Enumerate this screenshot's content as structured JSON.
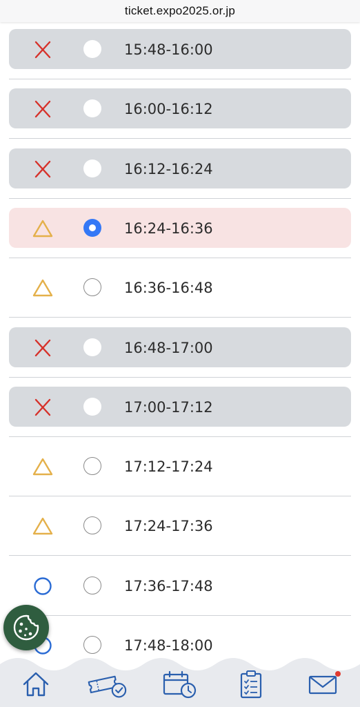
{
  "browser": {
    "url": "ticket.expo2025.or.jp"
  },
  "colors": {
    "unavailable_row": "#d7dade",
    "selected_row": "#f8e3e3",
    "cross": "#d6312a",
    "triangle": "#e4b04a",
    "circle": "#2a6bd4",
    "radio_selected": "#3478f6",
    "nav_icon": "#2a5fae"
  },
  "slots": [
    {
      "time": "15:48-16:00",
      "status": "full",
      "status_icon": "cross-icon",
      "radio": "disabled"
    },
    {
      "time": "16:00-16:12",
      "status": "full",
      "status_icon": "cross-icon",
      "radio": "disabled"
    },
    {
      "time": "16:12-16:24",
      "status": "full",
      "status_icon": "cross-icon",
      "radio": "disabled"
    },
    {
      "time": "16:24-16:36",
      "status": "few",
      "status_icon": "triangle-icon",
      "radio": "selected"
    },
    {
      "time": "16:36-16:48",
      "status": "few",
      "status_icon": "triangle-icon",
      "radio": "unselected"
    },
    {
      "time": "16:48-17:00",
      "status": "full",
      "status_icon": "cross-icon",
      "radio": "disabled"
    },
    {
      "time": "17:00-17:12",
      "status": "full",
      "status_icon": "cross-icon",
      "radio": "disabled"
    },
    {
      "time": "17:12-17:24",
      "status": "few",
      "status_icon": "triangle-icon",
      "radio": "unselected"
    },
    {
      "time": "17:24-17:36",
      "status": "few",
      "status_icon": "triangle-icon",
      "radio": "unselected"
    },
    {
      "time": "17:36-17:48",
      "status": "available",
      "status_icon": "circle-icon",
      "radio": "unselected"
    },
    {
      "time": "17:48-18:00",
      "status": "available",
      "status_icon": "circle-icon",
      "radio": "unselected"
    }
  ],
  "bottom_nav": {
    "items": [
      {
        "icon": "home-icon"
      },
      {
        "icon": "ticket-check-icon"
      },
      {
        "icon": "calendar-clock-icon"
      },
      {
        "icon": "clipboard-checklist-icon"
      },
      {
        "icon": "mail-icon",
        "notification": true
      }
    ]
  },
  "cookie_button": {
    "icon": "cookie-icon"
  }
}
